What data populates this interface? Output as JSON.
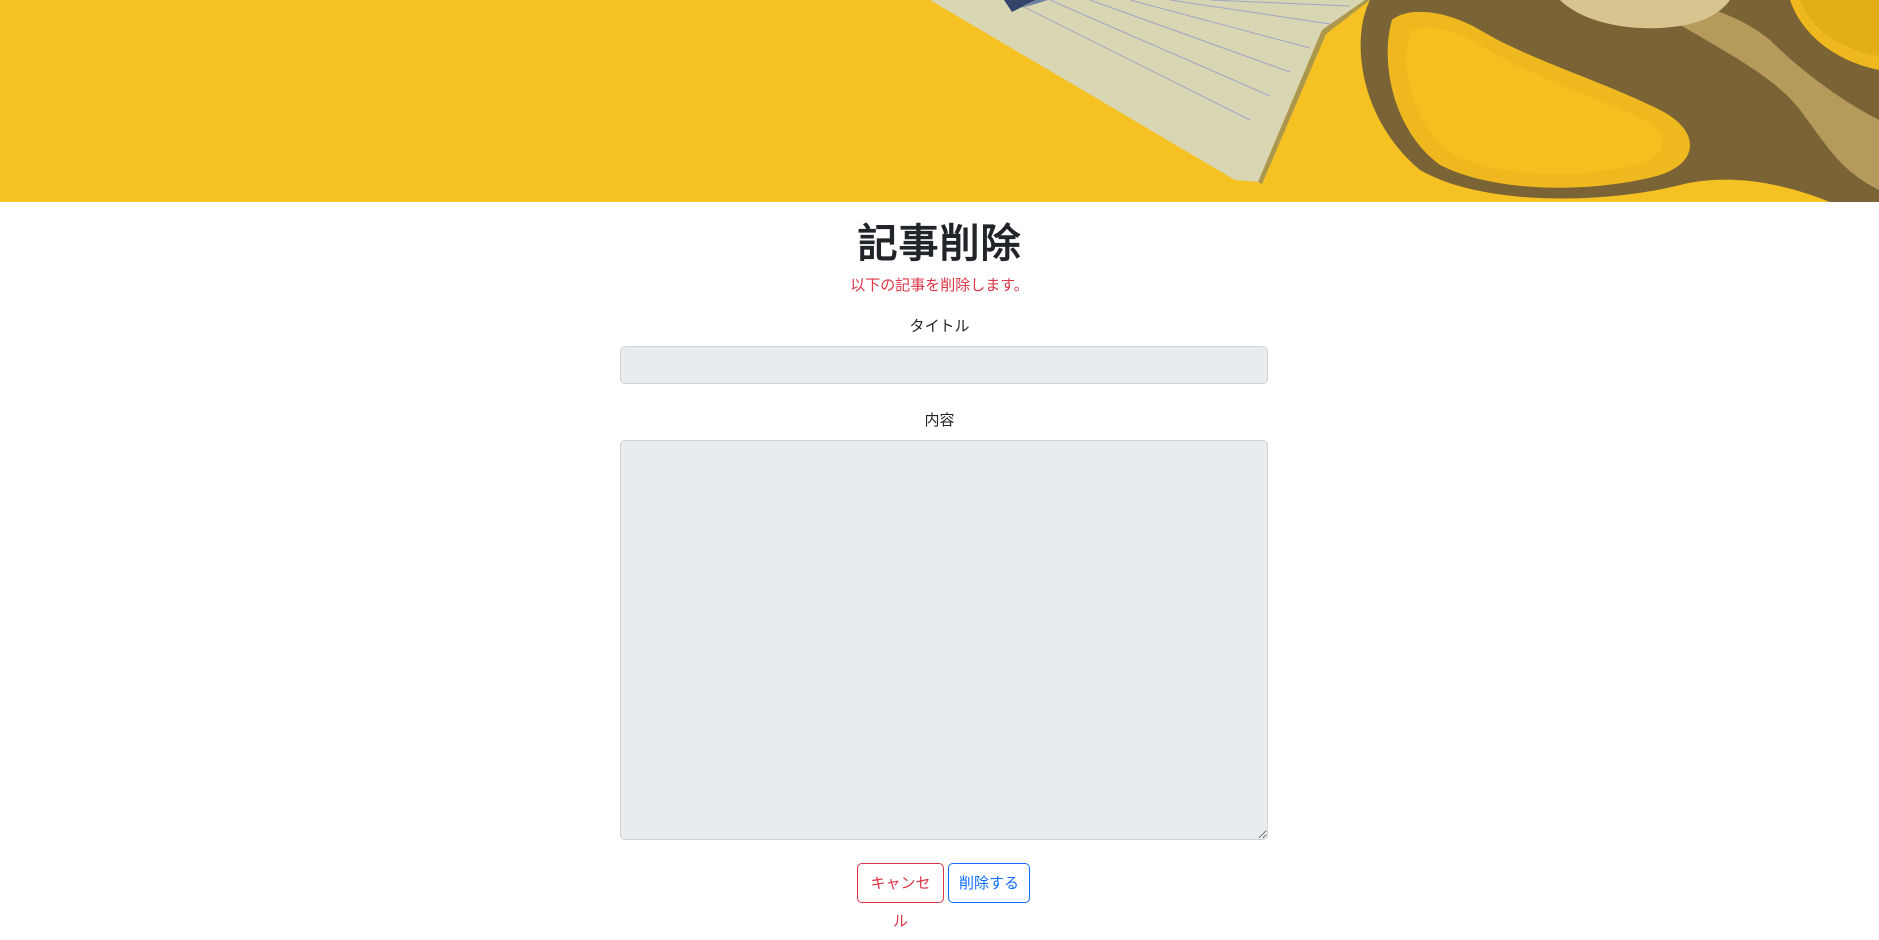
{
  "hero": {
    "image": "yellow-desk-notepad-scissors",
    "background_color": "#f4bf1f"
  },
  "page": {
    "title": "記事削除",
    "notice": "以下の記事を削除します。"
  },
  "form": {
    "title_label": "タイトル",
    "title_value": "",
    "content_label": "内容",
    "content_value": ""
  },
  "buttons": {
    "cancel_label": "キャンセル",
    "delete_label": "削除する"
  },
  "colors": {
    "danger": "#dc3545",
    "primary": "#0d6efd",
    "input_bg": "#e9ecef"
  }
}
